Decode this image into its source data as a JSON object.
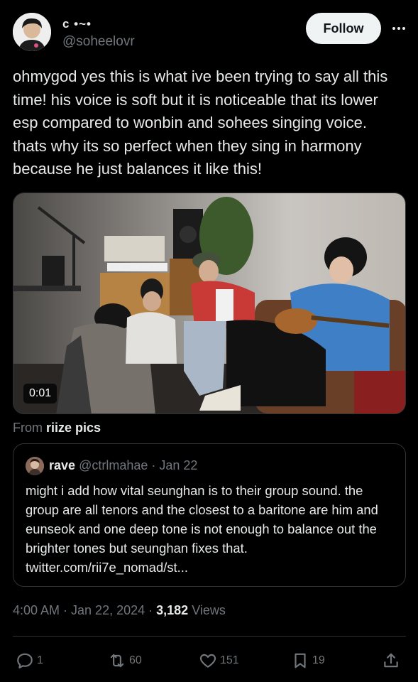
{
  "author": {
    "display_name": "c •~•",
    "handle": "@soheelovr",
    "avatar_icon": "profile-photo"
  },
  "follow_label": "Follow",
  "more_icon": "more-horizontal-icon",
  "tweet": {
    "text": "ohmygod yes this is what ive been trying to say all this time! his voice is soft but it is noticeable that its lower esp compared to wonbin and sohees singing voice. thats why its so perfect when they sing in harmony because he just balances it like this!"
  },
  "media": {
    "video_time": "0:01"
  },
  "source": {
    "prefix": "From",
    "name": "riize pics"
  },
  "quote": {
    "name": "rave",
    "handle": "@ctrlmahae",
    "date": "· Jan 22",
    "text": "might i add how vital seunghan is to their group sound. the group are all tenors and the closest to a baritone are him and eunseok and one deep tone is not enough to balance out the brighter tones but seunghan fixes that. twitter.com/rii7e_nomad/st..."
  },
  "meta": {
    "time": "4:00 AM · Jan 22, 2024 ·",
    "views_count": "3,182",
    "views_label": "Views"
  },
  "actions": {
    "replies": "1",
    "reposts": "60",
    "likes": "151",
    "bookmarks": "19"
  },
  "colors": {
    "background": "#000000",
    "text": "#e7e9ea",
    "secondary_text": "#71767b",
    "border": "#2f3336",
    "follow_bg": "#eff3f4"
  }
}
